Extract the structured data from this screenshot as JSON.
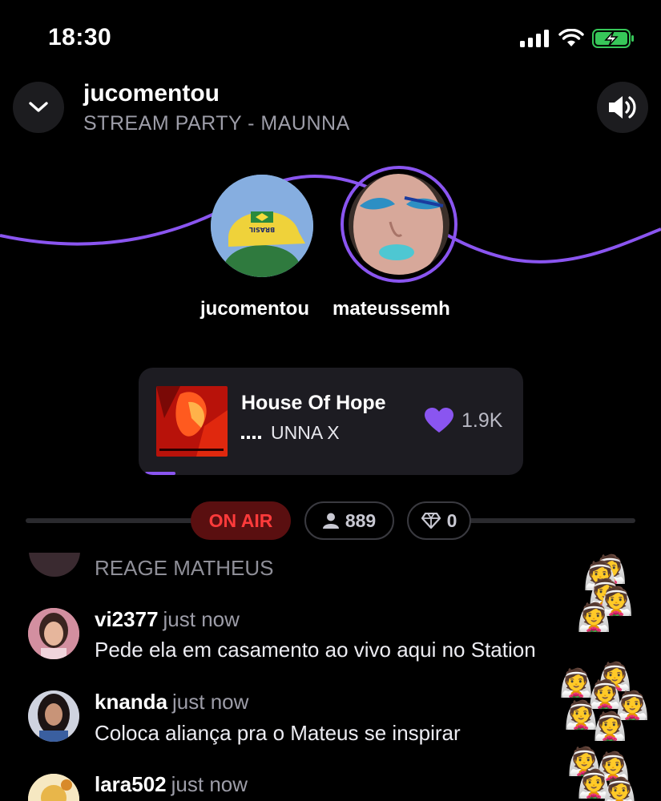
{
  "status_bar": {
    "time": "18:30"
  },
  "header": {
    "host": "jucomentou",
    "party": "STREAM PARTY - MAUNNA"
  },
  "participants": [
    {
      "name": "jucomentou"
    },
    {
      "name": "mateussemh"
    }
  ],
  "now_playing": {
    "title": "House Of Hope",
    "artist": "UNNA X",
    "likes": "1.9K",
    "progress": 0.08
  },
  "stats": {
    "on_air": "ON AIR",
    "listeners": "889",
    "diamonds": "0"
  },
  "chat": {
    "partial_message": "REAGE MATHEUS",
    "messages": [
      {
        "user": "vi2377",
        "time": "just now",
        "text": "Pede ela em casamento ao vivo aqui no Station"
      },
      {
        "user": "knanda",
        "time": "just now",
        "text": "Coloca aliança pra o Mateus se inspirar"
      },
      {
        "user": "lara502",
        "time": "just now"
      }
    ],
    "reaction_emoji": "👰"
  },
  "colors": {
    "accent": "#8a55f0",
    "on_air": "#ff3b3b",
    "background": "#000000"
  }
}
